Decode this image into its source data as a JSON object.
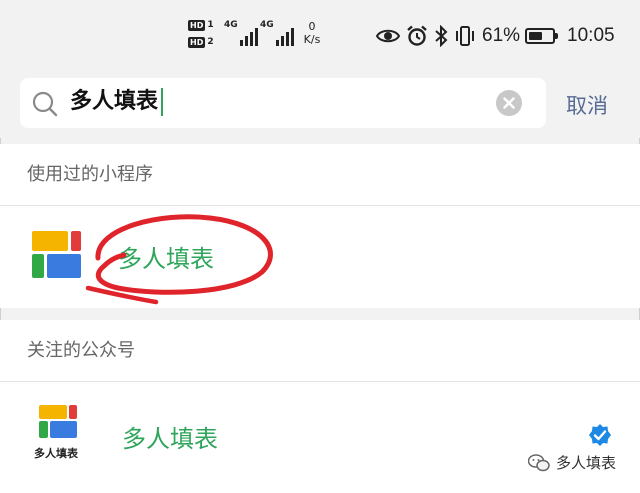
{
  "status_bar": {
    "hd1": "HD",
    "hd1_num": "1",
    "hd2": "HD",
    "hd2_num": "2",
    "sig1_label": "4G",
    "sig2_label": "4G",
    "net_speed_value": "0",
    "net_speed_unit": "K/s",
    "battery_percent": "61%",
    "battery_level": 0.61,
    "time": "10:05",
    "icons": [
      "eye-icon",
      "alarm-icon",
      "bluetooth-icon",
      "vibrate-icon",
      "battery-icon"
    ]
  },
  "search": {
    "value": "多人填表",
    "cancel_label": "取消"
  },
  "sections": {
    "mini_programs": {
      "title": "使用过的小程序",
      "items": [
        {
          "name": "多人填表"
        }
      ]
    },
    "official_accounts": {
      "title": "关注的公众号",
      "items": [
        {
          "name": "多人填表",
          "logo_text": "多人填表",
          "verified": true
        }
      ]
    }
  },
  "watermark": {
    "text": "多人填表"
  },
  "colors": {
    "accent_green": "#2ea55a",
    "link_blue": "#576b95",
    "annotation_red": "#e0242b",
    "verified_blue": "#1e88e5"
  }
}
